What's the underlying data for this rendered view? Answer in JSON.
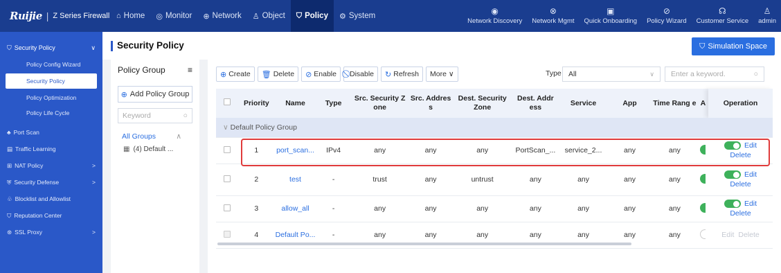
{
  "brand": {
    "logo": "Ruijie",
    "separator": "|",
    "series": "Z Series Firewall"
  },
  "topnav": [
    {
      "icon": "⌂",
      "label": "Home"
    },
    {
      "icon": "◎",
      "label": "Monitor"
    },
    {
      "icon": "⊕",
      "label": "Network"
    },
    {
      "icon": "♙",
      "label": "Object"
    },
    {
      "icon": "⛉",
      "label": "Policy"
    },
    {
      "icon": "⚙",
      "label": "System"
    }
  ],
  "toptools": [
    {
      "icon": "◉",
      "label": "Network Discovery"
    },
    {
      "icon": "⊗",
      "label": "Network Mgmt"
    },
    {
      "icon": "▣",
      "label": "Quick Onboarding"
    },
    {
      "icon": "⊘",
      "label": "Policy Wizard"
    },
    {
      "icon": "☊",
      "label": "Customer Service"
    },
    {
      "icon": "♙",
      "label": "admin"
    }
  ],
  "sidebar": {
    "group": {
      "label": "Security Policy",
      "icon": "⛉",
      "chevron": "∨"
    },
    "subitems": [
      "Policy Config Wizard",
      "Security Policy",
      "Policy Optimization",
      "Policy Life Cycle"
    ],
    "items": [
      {
        "icon": "♣",
        "label": "Port Scan",
        "chevron": ""
      },
      {
        "icon": "▤",
        "label": "Traffic Learning",
        "chevron": ""
      },
      {
        "icon": "⊞",
        "label": "NAT Policy",
        "chevron": ">"
      },
      {
        "icon": "⛨",
        "label": "Security Defense",
        "chevron": ">"
      },
      {
        "icon": "♧",
        "label": "Blocklist and Allowlist",
        "chevron": ""
      },
      {
        "icon": "⛉",
        "label": "Reputation Center",
        "chevron": ""
      },
      {
        "icon": "⊛",
        "label": "SSL Proxy",
        "chevron": ">"
      }
    ]
  },
  "page": {
    "title": "Security Policy",
    "sim_button": "Simulation Space",
    "sim_icon": "⛉"
  },
  "group_panel": {
    "title": "Policy Group",
    "menu_icon": "≡",
    "add_label": "Add Policy Group",
    "search_placeholder": "Keyword",
    "all_groups": "All Groups",
    "node": "(4) Default ..."
  },
  "toolbar": {
    "create": "Create",
    "delete": "Delete",
    "enable": "Enable",
    "disable": "Disable",
    "refresh": "Refresh",
    "more": "More ∨",
    "type_label": "Type",
    "type_value": "All",
    "keyword_placeholder": "Enter a keyword."
  },
  "table": {
    "headers": [
      "",
      "Priority",
      "Name",
      "Type",
      "Src. Security Z one",
      "Src. Addres s",
      "Dest. Security Zone",
      "Dest. Addr ess",
      "Service",
      "App",
      "Time Rang e",
      "A",
      "Operation"
    ],
    "group_row": "Default Policy Group",
    "rows": [
      {
        "priority": "1",
        "name": "port_scan...",
        "type": "IPv4",
        "src_zone": "any",
        "src_addr": "any",
        "dst_zone": "any",
        "dst_addr": "PortScan_...",
        "service": "service_2...",
        "app": "any",
        "time": "any",
        "enabled": true,
        "edit": "Edit",
        "delete": "Delete"
      },
      {
        "priority": "2",
        "name": "test",
        "type": "-",
        "src_zone": "trust",
        "src_addr": "any",
        "dst_zone": "untrust",
        "dst_addr": "any",
        "service": "any",
        "app": "any",
        "time": "any",
        "enabled": true,
        "edit": "Edit",
        "delete": "Delete"
      },
      {
        "priority": "3",
        "name": "allow_all",
        "type": "-",
        "src_zone": "any",
        "src_addr": "any",
        "dst_zone": "any",
        "dst_addr": "any",
        "service": "any",
        "app": "any",
        "time": "any",
        "enabled": true,
        "edit": "Edit",
        "delete": "Delete"
      },
      {
        "priority": "4",
        "name": "Default Po...",
        "type": "-",
        "src_zone": "any",
        "src_addr": "any",
        "dst_zone": "any",
        "dst_addr": "any",
        "service": "any",
        "app": "any",
        "time": "any",
        "enabled": false,
        "edit": "Edit",
        "delete": "Delete"
      }
    ]
  },
  "colors": {
    "topbar": "#1a3d8f",
    "sidebar": "#2a58c8",
    "accent": "#2a6ee0",
    "toggle_on": "#3eb15b",
    "highlight": "#e03b3b"
  }
}
